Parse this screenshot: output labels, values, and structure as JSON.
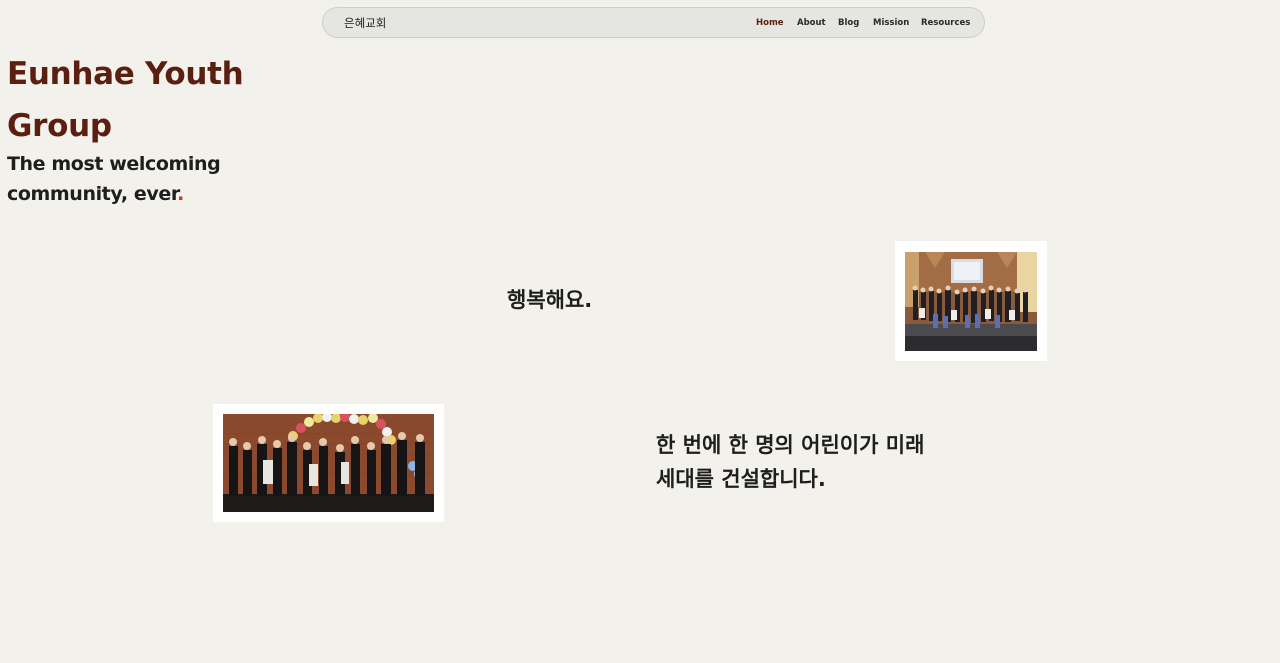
{
  "nav": {
    "brand": "은혜교회",
    "links": [
      {
        "label": "Home",
        "active": true
      },
      {
        "label": "About",
        "active": false
      },
      {
        "label": "Blog",
        "active": false
      },
      {
        "label": "Mission",
        "active": false
      },
      {
        "label": "Resources",
        "active": false
      }
    ]
  },
  "hero": {
    "title": "Eunhae Youth Group",
    "subtitle": "The most welcoming community, ever",
    "subtitle_end": "."
  },
  "sections": [
    {
      "text": "행복해요.",
      "image": "church-congregation-photo"
    },
    {
      "text": "한 번에 한 명의 어린이가 미래 세대를 건설합니다.",
      "image": "youth-group-performance-photo"
    }
  ],
  "colors": {
    "background": "#f3f1ec",
    "nav_background": "#e5e5e1",
    "accent": "#5a1f10",
    "text": "#1e1e1e"
  }
}
